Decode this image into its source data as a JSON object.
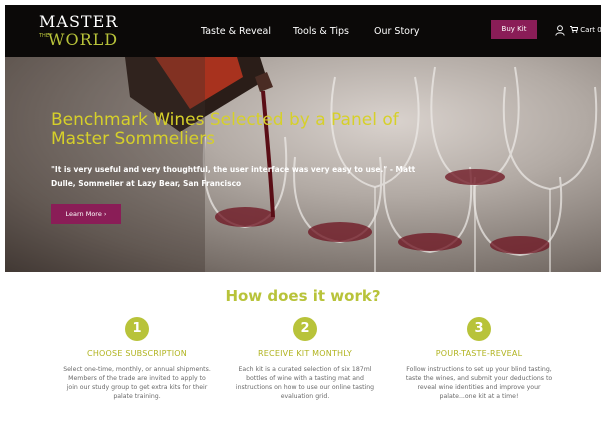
{
  "brand": {
    "line1": "MASTER",
    "the": "THE",
    "line2": "WORLD"
  },
  "nav": {
    "items": [
      {
        "label": "Taste & Reveal"
      },
      {
        "label": "Tools & Tips"
      },
      {
        "label": "Our Story"
      }
    ],
    "buy_label": "Buy Kit",
    "cart_label": "Cart 0",
    "user_icon": "user-icon",
    "cart_icon": "cart-icon"
  },
  "hero": {
    "title": "Benchmark Wines Selected by a Panel of Master Sommeliers",
    "quote": "\"It is very useful and very thoughtful, the user interface was very easy to use.\" - Matt Dulle, Sommelier at Lazy Bear, San Francisco",
    "cta_label": "Learn More ›",
    "slide_count": 4,
    "active_slide": 2
  },
  "how": {
    "title": "How does it work?",
    "steps": [
      {
        "number": "1",
        "title": "CHOOSE SUBSCRIPTION",
        "text": "Select one-time, monthly, or annual shipments. Members of the trade are invited to apply to join our study group to get extra kits for their palate training."
      },
      {
        "number": "2",
        "title": "RECEIVE KIT MONTHLY",
        "text": "Each kit is a curated selection of six 187ml bottles of wine with a tasting mat and instructions on how to use our online tasting evaluation grid."
      },
      {
        "number": "3",
        "title": "POUR-TASTE-REVEAL",
        "text": "Follow instructions to set up your blind tasting, taste the wines, and submit your deductions to reveal wine identities and improve your palate...one kit at a time!"
      }
    ]
  },
  "colors": {
    "accent_green": "#b8c33a",
    "brand_magenta": "#8a1d57",
    "header_bg": "#0b0908"
  }
}
